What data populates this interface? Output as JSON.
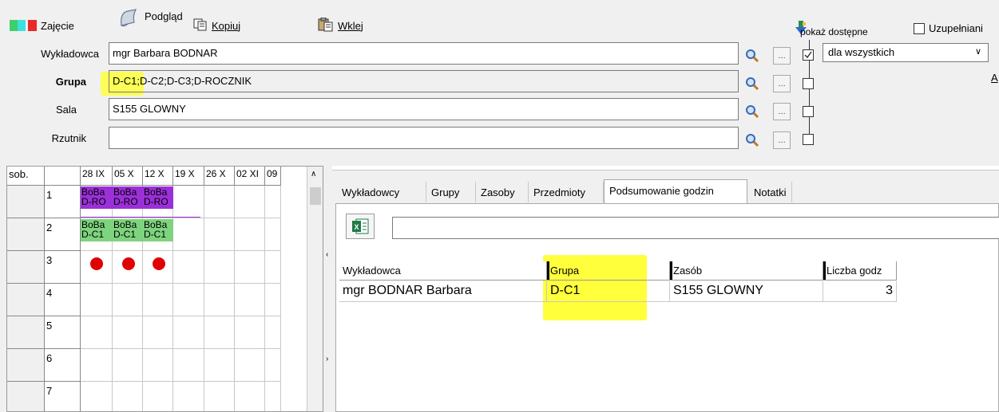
{
  "toolbar": {
    "zajecie_label": "Zajęcie",
    "podglad_label": "Podgląd",
    "kopiuj_label": "Kopiuj",
    "wklej_label": "Wklej"
  },
  "fields": {
    "wykladowca_label": "Wykładowca",
    "wykladowca_value": "mgr Barbara BODNAR",
    "grupa_label": "Grupa",
    "grupa_value": "D-C1;D-C2;D-C3;D-ROCZNIK",
    "sala_label": "Sala",
    "sala_value": "S155 GLOWNY",
    "rzutnik_label": "Rzutnik",
    "rzutnik_value": ""
  },
  "availability": {
    "pokaz_label": "pokaż dostępne",
    "uzupelnianie_label": "Uzupełniani",
    "select_value": "dla wszystkich",
    "edge_letter": "A"
  },
  "grid": {
    "day_label": "sob.",
    "weeks": [
      "28 IX",
      "05 X",
      "12 X",
      "19 X",
      "26 X",
      "02 XI",
      "09"
    ],
    "rows": [
      "1",
      "2",
      "3",
      "4",
      "5",
      "6",
      "7"
    ],
    "row1_events": [
      {
        "top": "BoBa",
        "bottom": "D-RO"
      },
      {
        "top": "BoBa",
        "bottom": "D-RO"
      },
      {
        "top": "BoBa",
        "bottom": "D-RO"
      }
    ],
    "row2_events": [
      {
        "top": "BoBa",
        "bottom": "D-C1"
      },
      {
        "top": "BoBa",
        "bottom": "D-C1"
      },
      {
        "top": "BoBa",
        "bottom": "D-C1"
      }
    ]
  },
  "tabs": [
    "Wykładowcy",
    "Grupy",
    "Zasoby",
    "Przedmioty",
    "Podsumowanie godzin",
    "Notatki"
  ],
  "table": {
    "headers": [
      "Wykładowca",
      "Grupa",
      "Zasób",
      "Liczba godz"
    ],
    "rows": [
      {
        "wykladowca": "mgr BODNAR Barbara",
        "grupa": "D-C1",
        "zasob": "S155 GLOWNY",
        "godz": "3"
      }
    ]
  },
  "colors": {
    "highlight": "#ffff3c",
    "purple_event": "#9b30d9",
    "green_event": "#7ed47e",
    "red_dot": "#e00000"
  }
}
